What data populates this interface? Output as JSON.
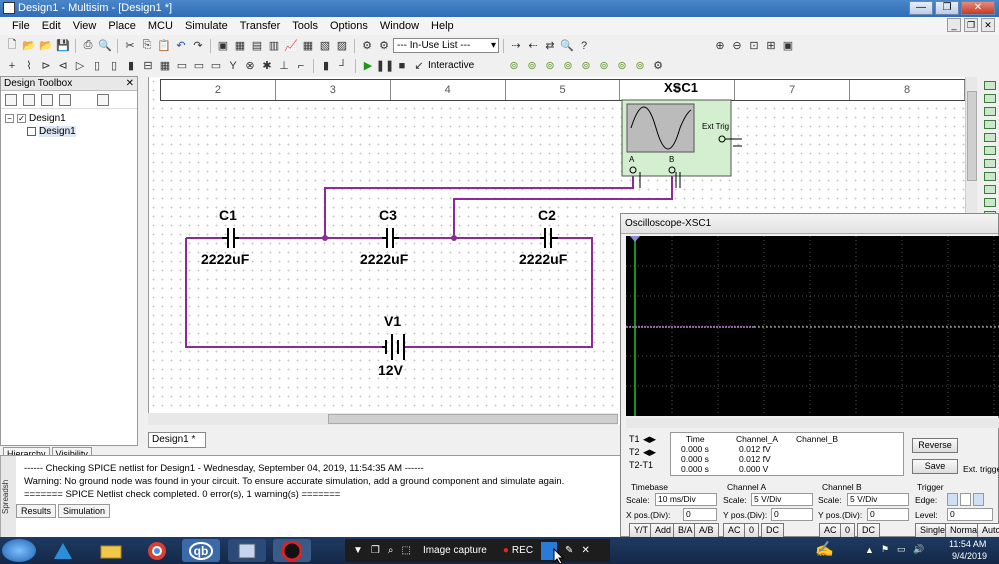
{
  "window": {
    "title": "Design1 - Multisim - [Design1 *]"
  },
  "menu": [
    "File",
    "Edit",
    "View",
    "Place",
    "MCU",
    "Simulate",
    "Transfer",
    "Tools",
    "Options",
    "Window",
    "Help"
  ],
  "toolbar": {
    "in_use_list": "--- In-Use List ---",
    "interactive_label": "Interactive"
  },
  "toolbox": {
    "title": "Design Toolbox",
    "tree": [
      {
        "label": "Design1"
      },
      {
        "label": "Design1"
      }
    ],
    "tabs": [
      "Hierarchy",
      "Visibility"
    ]
  },
  "ruler": [
    "2",
    "3",
    "4",
    "5",
    "6",
    "7",
    "8"
  ],
  "schematic": {
    "components": [
      {
        "ref": "C1",
        "value": "2222uF"
      },
      {
        "ref": "C3",
        "value": "2222uF"
      },
      {
        "ref": "C2",
        "value": "2222uF"
      },
      {
        "ref": "V1",
        "value": "12V"
      }
    ],
    "scope": {
      "ref": "XSC1",
      "ext_trig": "Ext Trig",
      "a": "A",
      "b": "B"
    }
  },
  "sheet_tab": "Design1 *",
  "spreadsheet": {
    "side_label": "Spreadsh",
    "lines": [
      "------ Checking SPICE netlist for Design1 - Wednesday, September 04, 2019, 11:54:35 AM ------",
      "Warning: No ground node was found in your circuit. To ensure accurate simulation, add a ground component and simulate again.",
      "======= SPICE Netlist check completed. 0 error(s), 1 warning(s) ======="
    ],
    "tabs": [
      "Results",
      "Simulation"
    ]
  },
  "oscilloscope": {
    "title": "Oscilloscope-XSC1",
    "headers": [
      "Time",
      "Channel_A",
      "Channel_B"
    ],
    "rows": [
      {
        "label": "T1",
        "time": "0.000 s",
        "a": "0.012 fV",
        "b": ""
      },
      {
        "label": "T2",
        "time": "0.000 s",
        "a": "0.012 fV",
        "b": ""
      },
      {
        "label": "T2-T1",
        "time": "0.000 s",
        "a": "0.000 V",
        "b": ""
      }
    ],
    "reverse": "Reverse",
    "save": "Save",
    "ext_trigger": "Ext. trigge",
    "timebase": {
      "title": "Timebase",
      "scale_label": "Scale:",
      "scale": "10 ms/Div",
      "xpos_label": "X pos.(Div):",
      "xpos": "0"
    },
    "channel_a": {
      "title": "Channel A",
      "scale_label": "Scale:",
      "scale": "5  V/Div",
      "ypos_label": "Y pos.(Div):",
      "ypos": "0"
    },
    "channel_b": {
      "title": "Channel B",
      "scale_label": "Scale:",
      "scale": "5  V/Div",
      "ypos_label": "Y pos.(Div):",
      "ypos": "0"
    },
    "trigger": {
      "title": "Trigger",
      "edge_label": "Edge:",
      "level_label": "Level:",
      "level": "0"
    },
    "bottom_buttons": [
      "Y/T",
      "Add",
      "B/A",
      "A/B",
      "AC",
      "0",
      "DC",
      "AC",
      "0",
      "DC",
      "Single",
      "Normal",
      "Auto"
    ]
  },
  "taskbar": {
    "capture_label": "Image capture",
    "rec_label": "REC",
    "time": "11:54 AM",
    "date": "9/4/2019"
  },
  "colors": {
    "wire": "#8e2a98",
    "trace": "#c080d0",
    "scope_bg": "#000000"
  }
}
